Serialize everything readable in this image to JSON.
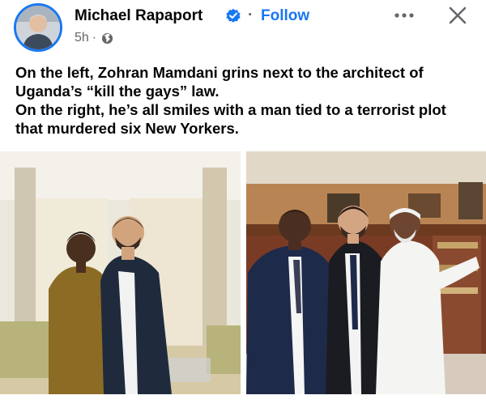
{
  "header": {
    "author_name": "Michael Rapaport",
    "separator": "·",
    "follow_label": "Follow",
    "timestamp": "5h",
    "meta_separator": "·",
    "privacy_icon": "globe-icon",
    "verified_icon": "verified-badge-icon",
    "more_icon": "more-options-icon",
    "close_icon": "close-icon"
  },
  "post": {
    "lines": [
      "On the left, Zohran Mamdani grins next to the architect of Uganda’s “kill the gays” law.",
      "On the right, he’s all smiles with a man tied to a terrorist plot that murdered six New Yorkers."
    ]
  },
  "colors": {
    "accent": "#1877f2",
    "text": "#050505",
    "secondary_text": "#65676b"
  }
}
